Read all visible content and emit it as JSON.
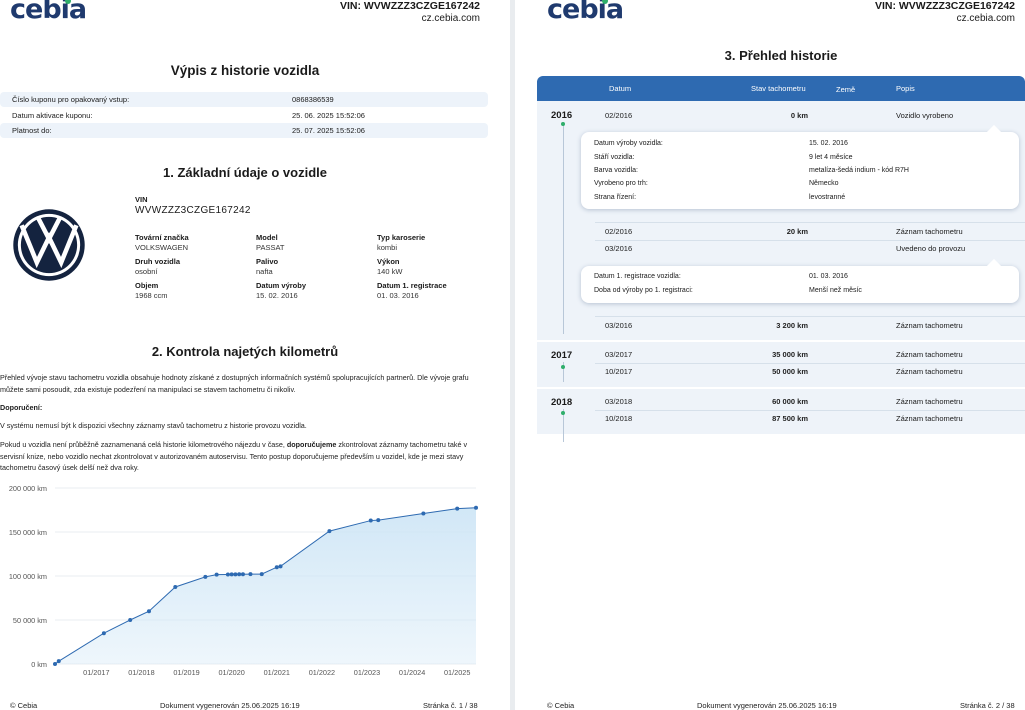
{
  "brand": {
    "logo_text": "cebia",
    "website": "cz.cebia.com"
  },
  "vin_header": "VIN: WVWZZZ3CZGE167242",
  "page1": {
    "title": "Výpis z historie vozidla",
    "coupon": [
      {
        "label": "Číslo kuponu pro opakovaný vstup:",
        "value": "0868386539"
      },
      {
        "label": "Datum aktivace kuponu:",
        "value": "25. 06. 2025 15:52:06"
      },
      {
        "label": "Platnost do:",
        "value": "25. 07. 2025 15:52:06"
      }
    ],
    "section1_title": "1. Základní údaje o vozidle",
    "vin_label": "VIN",
    "vin_value": "WVWZZZ3CZGE167242",
    "fields": [
      {
        "label": "Tovární značka",
        "value": "VOLKSWAGEN"
      },
      {
        "label": "Model",
        "value": "PASSAT"
      },
      {
        "label": "Typ karoserie",
        "value": "kombi"
      },
      {
        "label": "Druh vozidla",
        "value": "osobní"
      },
      {
        "label": "Palivo",
        "value": "nafta"
      },
      {
        "label": "Výkon",
        "value": "140 kW"
      },
      {
        "label": "Objem",
        "value": "1968 ccm"
      },
      {
        "label": "Datum výroby",
        "value": "15. 02. 2016"
      },
      {
        "label": "Datum 1. registrace",
        "value": "01. 03. 2016"
      }
    ],
    "section2_title": "2. Kontrola najetých kilometrů",
    "para1": "Přehled vývoje stavu tachometru vozidla obsahuje hodnoty získané z dostupných informačních systémů spolupracujících partnerů. Dle vývoje grafu můžete sami posoudit, zda existuje podezření na manipulaci se stavem tachometru či nikoliv.",
    "recommend_label": "Doporučení:",
    "para2": "V systému nemusí být k dispozici všechny záznamy stavů tachometru z historie provozu vozidla.",
    "para3_pre": "Pokud u vozidla není průběžně zaznamenaná celá historie kilometrového nájezdu v čase,",
    "para3_bold": "doporučujeme",
    "para3_post": "zkontrolovat záznamy tachometru také v servisní knize, nebo vozidlo nechat zkontrolovat v autorizovaném autoservisu. Tento postup doporučujeme především u vozidel, kde je mezi stavy tachometru časový úsek delší než dva roky.",
    "footer": {
      "copyright": "© Cebia",
      "generated": "Dokument vygenerován 25.06.2025 16:19",
      "page": "Stránka č. 1 / 38"
    }
  },
  "chart_data": {
    "type": "area",
    "title": "",
    "xlabel": "",
    "ylabel": "",
    "y_tick_labels": [
      "0 km",
      "50 000 km",
      "100 000 km",
      "150 000 km",
      "200 000 km"
    ],
    "y_ticks": [
      0,
      50000,
      100000,
      150000,
      200000
    ],
    "ylim": [
      0,
      200000
    ],
    "x_tick_labels": [
      "01/2017",
      "01/2018",
      "01/2019",
      "01/2020",
      "01/2021",
      "01/2022",
      "01/2023",
      "01/2024",
      "01/2025"
    ],
    "xlim": [
      "2016-02",
      "2025-06"
    ],
    "grid": true,
    "color": "#2e6ab1",
    "fill": "#cfe6f6",
    "points": [
      {
        "x": "2016-02",
        "y": 0
      },
      {
        "x": "2016-03",
        "y": 3200
      },
      {
        "x": "2017-03",
        "y": 35000
      },
      {
        "x": "2017-10",
        "y": 50000
      },
      {
        "x": "2018-03",
        "y": 60000
      },
      {
        "x": "2018-10",
        "y": 87500
      },
      {
        "x": "2019-06",
        "y": 99000
      },
      {
        "x": "2019-09",
        "y": 101500
      },
      {
        "x": "2019-12",
        "y": 101700
      },
      {
        "x": "2020-01",
        "y": 101800
      },
      {
        "x": "2020-02",
        "y": 101900
      },
      {
        "x": "2020-03",
        "y": 102000
      },
      {
        "x": "2020-04",
        "y": 102000
      },
      {
        "x": "2020-06",
        "y": 102100
      },
      {
        "x": "2020-09",
        "y": 102200
      },
      {
        "x": "2021-01",
        "y": 110000
      },
      {
        "x": "2021-02",
        "y": 111000
      },
      {
        "x": "2022-03",
        "y": 151000
      },
      {
        "x": "2023-02",
        "y": 163000
      },
      {
        "x": "2023-04",
        "y": 163500
      },
      {
        "x": "2024-04",
        "y": 171000
      },
      {
        "x": "2025-01",
        "y": 176500
      },
      {
        "x": "2025-06",
        "y": 177500
      }
    ]
  },
  "page2": {
    "title": "3. Přehled historie",
    "headers": {
      "date": "Datum",
      "odometer": "Stav tachometru",
      "country": "Země",
      "desc": "Popis"
    },
    "years": [
      {
        "year": "2016",
        "rows": [
          {
            "date": "02/2016",
            "km": "0 km",
            "desc": "Vozidlo vyrobeno"
          },
          {
            "date": "02/2016",
            "km": "20 km",
            "desc": "Záznam tachometru"
          },
          {
            "date": "03/2016",
            "km": "",
            "desc": "Uvedeno do provozu"
          },
          {
            "date": "03/2016",
            "km": "3 200 km",
            "desc": "Záznam tachometru"
          }
        ],
        "card1": [
          {
            "k": "Datum výroby vozidla:",
            "v": "15. 02. 2016"
          },
          {
            "k": "Stáří vozidla:",
            "v": "9 let 4 měsíce"
          },
          {
            "k": "Barva vozidla:",
            "v": "metalíza-šedá indium - kód R7H"
          },
          {
            "k": "Vyrobeno pro trh:",
            "v": "Německo"
          },
          {
            "k": "Strana řízení:",
            "v": "levostranné"
          }
        ],
        "card2": [
          {
            "k": "Datum 1. registrace vozidla:",
            "v": "01. 03. 2016"
          },
          {
            "k": "Doba od výroby po 1. registraci:",
            "v": "Menší než měsíc"
          }
        ]
      },
      {
        "year": "2017",
        "rows": [
          {
            "date": "03/2017",
            "km": "35 000 km",
            "desc": "Záznam tachometru"
          },
          {
            "date": "10/2017",
            "km": "50 000 km",
            "desc": "Záznam tachometru"
          }
        ]
      },
      {
        "year": "2018",
        "rows": [
          {
            "date": "03/2018",
            "km": "60 000 km",
            "desc": "Záznam tachometru"
          },
          {
            "date": "10/2018",
            "km": "87 500 km",
            "desc": "Záznam tachometru"
          }
        ]
      }
    ],
    "footer": {
      "copyright": "© Cebia",
      "generated": "Dokument vygenerován 25.06.2025 16:19",
      "page": "Stránka č. 2 / 38"
    }
  }
}
